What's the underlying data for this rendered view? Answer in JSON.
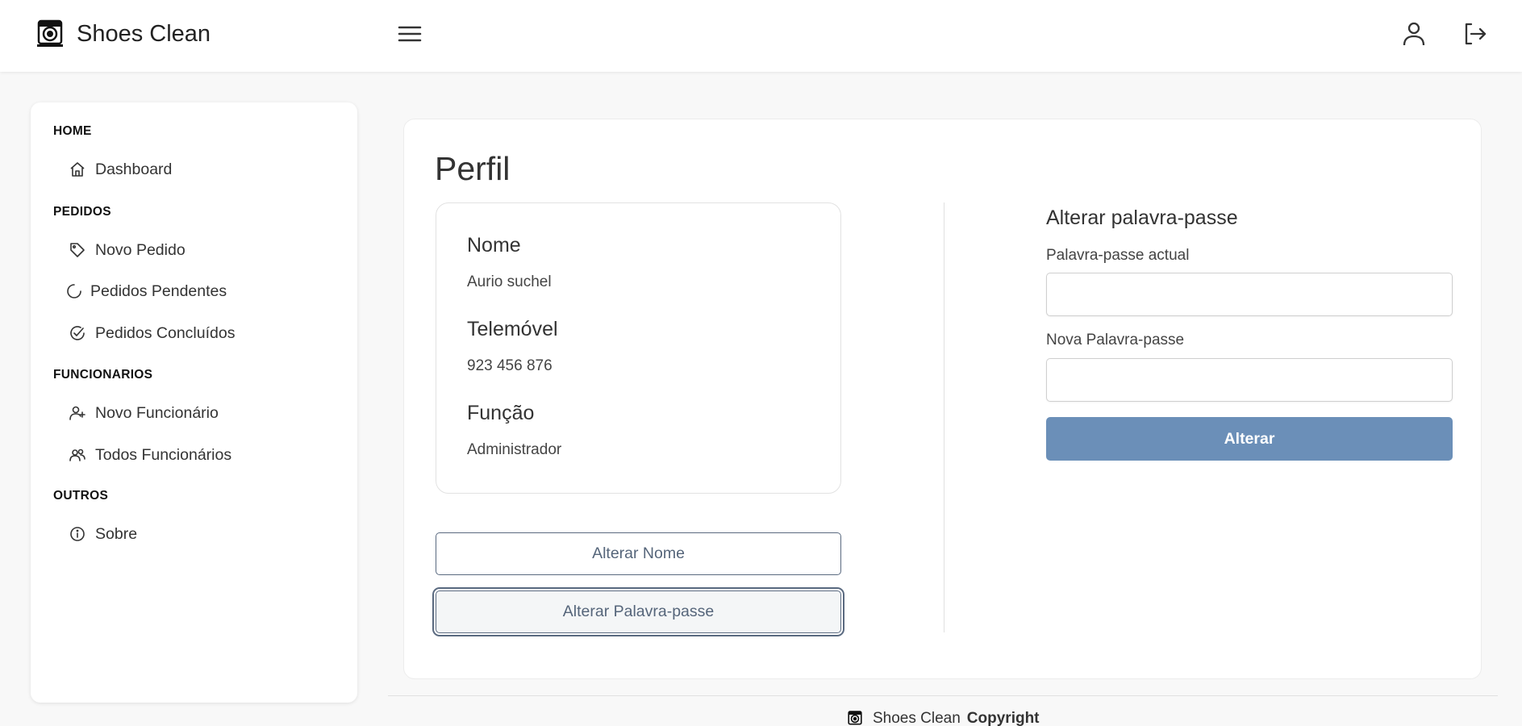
{
  "header": {
    "brand": "Shoes Clean",
    "logo_icon": "washing-machine-logo",
    "menu_icon": "hamburger-menu-icon",
    "user_icon": "user-icon",
    "logout_icon": "logout-icon"
  },
  "sidebar": {
    "sections": [
      {
        "title": "HOME",
        "items": [
          {
            "label": "Dashboard",
            "icon": "home-icon"
          }
        ]
      },
      {
        "title": "PEDIDOS",
        "items": [
          {
            "label": "Novo Pedido",
            "icon": "tag-icon"
          },
          {
            "label": "Pedidos Pendentes",
            "icon": "loading-circle-icon"
          },
          {
            "label": "Pedidos Concluídos",
            "icon": "check-circle-icon"
          }
        ]
      },
      {
        "title": "FUNCIONARIOS",
        "items": [
          {
            "label": "Novo Funcionário",
            "icon": "user-plus-icon"
          },
          {
            "label": "Todos Funcionários",
            "icon": "users-icon"
          }
        ]
      },
      {
        "title": "OUTROS",
        "items": [
          {
            "label": "Sobre",
            "icon": "info-icon"
          }
        ]
      }
    ]
  },
  "main": {
    "title": "Perfil",
    "profile": {
      "name_label": "Nome",
      "name_value": "Aurio suchel",
      "phone_label": "Telemóvel",
      "phone_value": "923 456 876",
      "role_label": "Função",
      "role_value": "Administrador"
    },
    "buttons": {
      "change_name": "Alterar Nome",
      "change_password": "Alterar Palavra-passe"
    },
    "password_form": {
      "title": "Alterar palavra-passe",
      "current_label": "Palavra-passe actual",
      "current_value": "",
      "new_label": "Nova Palavra-passe",
      "new_value": "",
      "submit": "Alterar"
    }
  },
  "footer": {
    "brand": "Shoes Clean",
    "copyright": "Copyright"
  },
  "colors": {
    "primary_button": "#6b8fb8",
    "outline_button": "#5a6a80",
    "background": "#f8f8f8"
  }
}
